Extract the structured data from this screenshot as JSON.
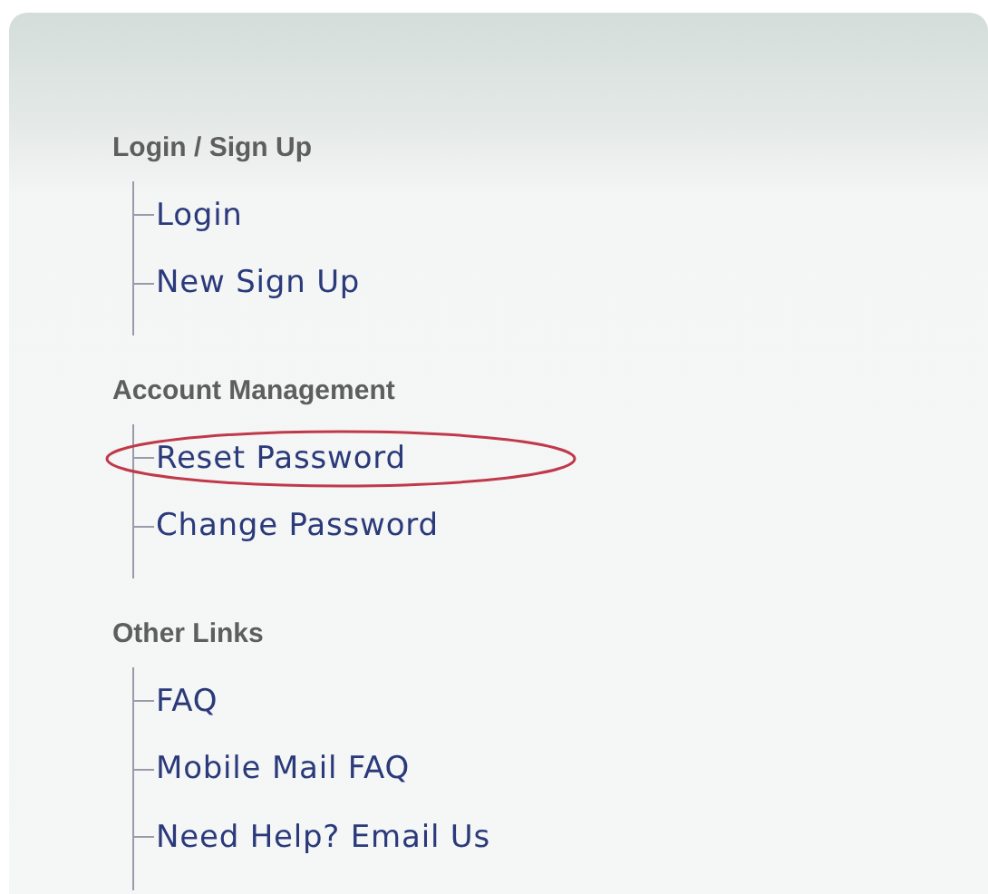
{
  "groups": [
    {
      "heading": "Login / Sign Up",
      "items": [
        {
          "label": "Login",
          "circled": false
        },
        {
          "label": "New Sign Up",
          "circled": false
        }
      ]
    },
    {
      "heading": "Account Management",
      "items": [
        {
          "label": "Reset Password",
          "circled": true
        },
        {
          "label": "Change Password",
          "circled": false
        }
      ]
    },
    {
      "heading": "Other Links",
      "items": [
        {
          "label": "FAQ",
          "circled": false
        },
        {
          "label": "Mobile Mail FAQ",
          "circled": false
        },
        {
          "label": "Need Help? Email Us",
          "circled": false
        }
      ]
    }
  ]
}
